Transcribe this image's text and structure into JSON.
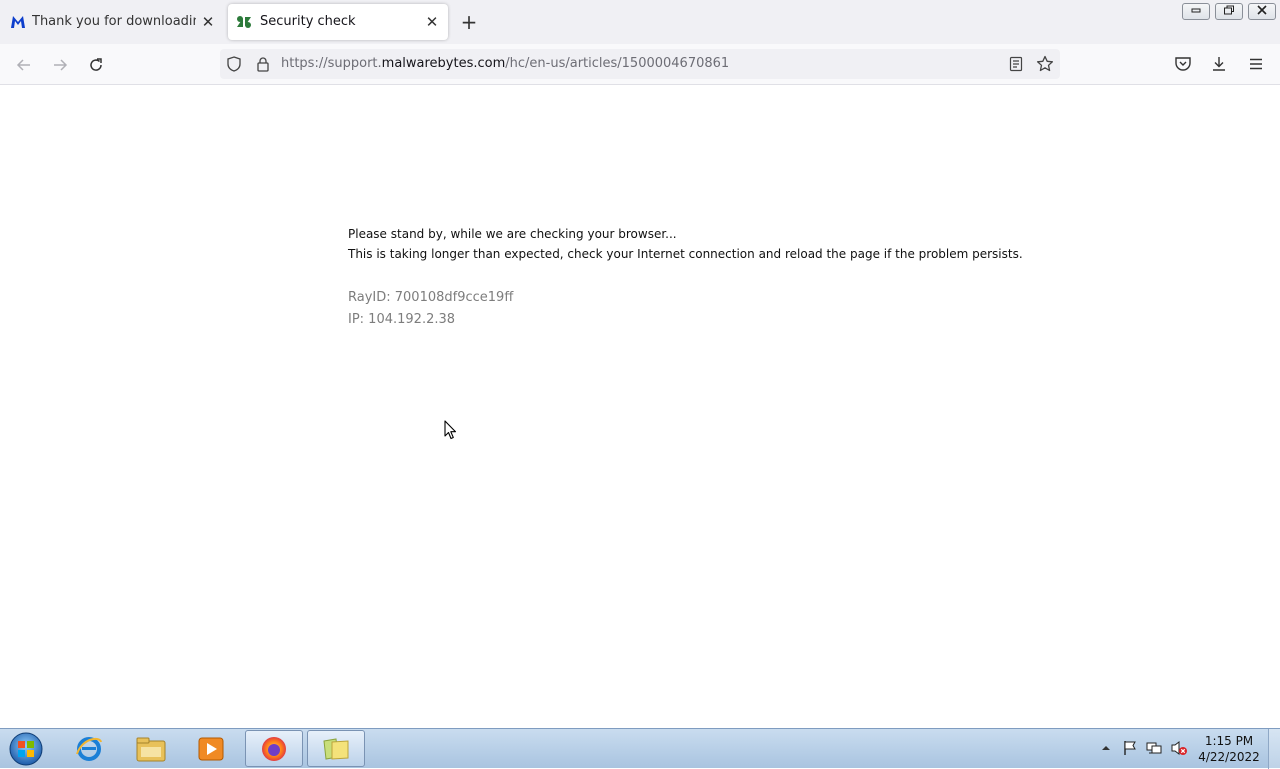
{
  "browser": {
    "tabs": [
      {
        "title": "Thank you for downloading Ma",
        "active": false,
        "icon": "malwarebytes-logo-icon"
      },
      {
        "title": "Security check",
        "active": true,
        "icon": "zendesk-logo-icon"
      }
    ],
    "newtab_symbol": "+",
    "close_symbol": "✕",
    "window_controls": {
      "minimize": "▭",
      "maximize": "⧉",
      "close": "✕"
    },
    "url": {
      "scheme": "https://support.",
      "host": "malwarebytes.com",
      "path": "/hc/en-us/articles/1500004670861"
    }
  },
  "page": {
    "line1": "Please stand by, while we are checking your browser...",
    "line2": "This is taking longer than expected, check your Internet connection and reload the page if the problem persists.",
    "ray_id": "RayID: 700108df9cce19ff",
    "ip": "IP: 104.192.2.38"
  },
  "taskbar": {
    "items": [
      "internet-explorer-icon",
      "file-explorer-icon",
      "media-player-icon",
      "firefox-icon",
      "folder-window-icon"
    ],
    "time": "1:15 PM",
    "date": "4/22/2022"
  },
  "colors": {
    "accent_tab": "#ffffff",
    "malwarebytes_blue": "#0d3ecc",
    "zendesk_green": "#03363d"
  }
}
